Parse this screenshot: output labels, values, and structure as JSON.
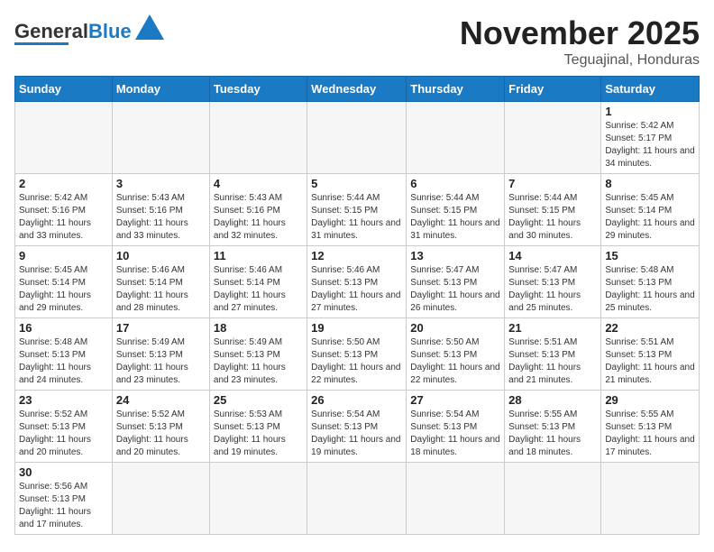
{
  "header": {
    "logo_text_normal": "General",
    "logo_text_colored": "Blue",
    "month_title": "November 2025",
    "location": "Teguajinal, Honduras"
  },
  "weekdays": [
    "Sunday",
    "Monday",
    "Tuesday",
    "Wednesday",
    "Thursday",
    "Friday",
    "Saturday"
  ],
  "days": {
    "1": {
      "sunrise": "5:42 AM",
      "sunset": "5:17 PM",
      "daylight": "11 hours and 34 minutes."
    },
    "2": {
      "sunrise": "5:42 AM",
      "sunset": "5:16 PM",
      "daylight": "11 hours and 33 minutes."
    },
    "3": {
      "sunrise": "5:43 AM",
      "sunset": "5:16 PM",
      "daylight": "11 hours and 33 minutes."
    },
    "4": {
      "sunrise": "5:43 AM",
      "sunset": "5:16 PM",
      "daylight": "11 hours and 32 minutes."
    },
    "5": {
      "sunrise": "5:44 AM",
      "sunset": "5:15 PM",
      "daylight": "11 hours and 31 minutes."
    },
    "6": {
      "sunrise": "5:44 AM",
      "sunset": "5:15 PM",
      "daylight": "11 hours and 31 minutes."
    },
    "7": {
      "sunrise": "5:44 AM",
      "sunset": "5:15 PM",
      "daylight": "11 hours and 30 minutes."
    },
    "8": {
      "sunrise": "5:45 AM",
      "sunset": "5:14 PM",
      "daylight": "11 hours and 29 minutes."
    },
    "9": {
      "sunrise": "5:45 AM",
      "sunset": "5:14 PM",
      "daylight": "11 hours and 29 minutes."
    },
    "10": {
      "sunrise": "5:46 AM",
      "sunset": "5:14 PM",
      "daylight": "11 hours and 28 minutes."
    },
    "11": {
      "sunrise": "5:46 AM",
      "sunset": "5:14 PM",
      "daylight": "11 hours and 27 minutes."
    },
    "12": {
      "sunrise": "5:46 AM",
      "sunset": "5:13 PM",
      "daylight": "11 hours and 27 minutes."
    },
    "13": {
      "sunrise": "5:47 AM",
      "sunset": "5:13 PM",
      "daylight": "11 hours and 26 minutes."
    },
    "14": {
      "sunrise": "5:47 AM",
      "sunset": "5:13 PM",
      "daylight": "11 hours and 25 minutes."
    },
    "15": {
      "sunrise": "5:48 AM",
      "sunset": "5:13 PM",
      "daylight": "11 hours and 25 minutes."
    },
    "16": {
      "sunrise": "5:48 AM",
      "sunset": "5:13 PM",
      "daylight": "11 hours and 24 minutes."
    },
    "17": {
      "sunrise": "5:49 AM",
      "sunset": "5:13 PM",
      "daylight": "11 hours and 23 minutes."
    },
    "18": {
      "sunrise": "5:49 AM",
      "sunset": "5:13 PM",
      "daylight": "11 hours and 23 minutes."
    },
    "19": {
      "sunrise": "5:50 AM",
      "sunset": "5:13 PM",
      "daylight": "11 hours and 22 minutes."
    },
    "20": {
      "sunrise": "5:50 AM",
      "sunset": "5:13 PM",
      "daylight": "11 hours and 22 minutes."
    },
    "21": {
      "sunrise": "5:51 AM",
      "sunset": "5:13 PM",
      "daylight": "11 hours and 21 minutes."
    },
    "22": {
      "sunrise": "5:51 AM",
      "sunset": "5:13 PM",
      "daylight": "11 hours and 21 minutes."
    },
    "23": {
      "sunrise": "5:52 AM",
      "sunset": "5:13 PM",
      "daylight": "11 hours and 20 minutes."
    },
    "24": {
      "sunrise": "5:52 AM",
      "sunset": "5:13 PM",
      "daylight": "11 hours and 20 minutes."
    },
    "25": {
      "sunrise": "5:53 AM",
      "sunset": "5:13 PM",
      "daylight": "11 hours and 19 minutes."
    },
    "26": {
      "sunrise": "5:54 AM",
      "sunset": "5:13 PM",
      "daylight": "11 hours and 19 minutes."
    },
    "27": {
      "sunrise": "5:54 AM",
      "sunset": "5:13 PM",
      "daylight": "11 hours and 18 minutes."
    },
    "28": {
      "sunrise": "5:55 AM",
      "sunset": "5:13 PM",
      "daylight": "11 hours and 18 minutes."
    },
    "29": {
      "sunrise": "5:55 AM",
      "sunset": "5:13 PM",
      "daylight": "11 hours and 17 minutes."
    },
    "30": {
      "sunrise": "5:56 AM",
      "sunset": "5:13 PM",
      "daylight": "11 hours and 17 minutes."
    }
  }
}
